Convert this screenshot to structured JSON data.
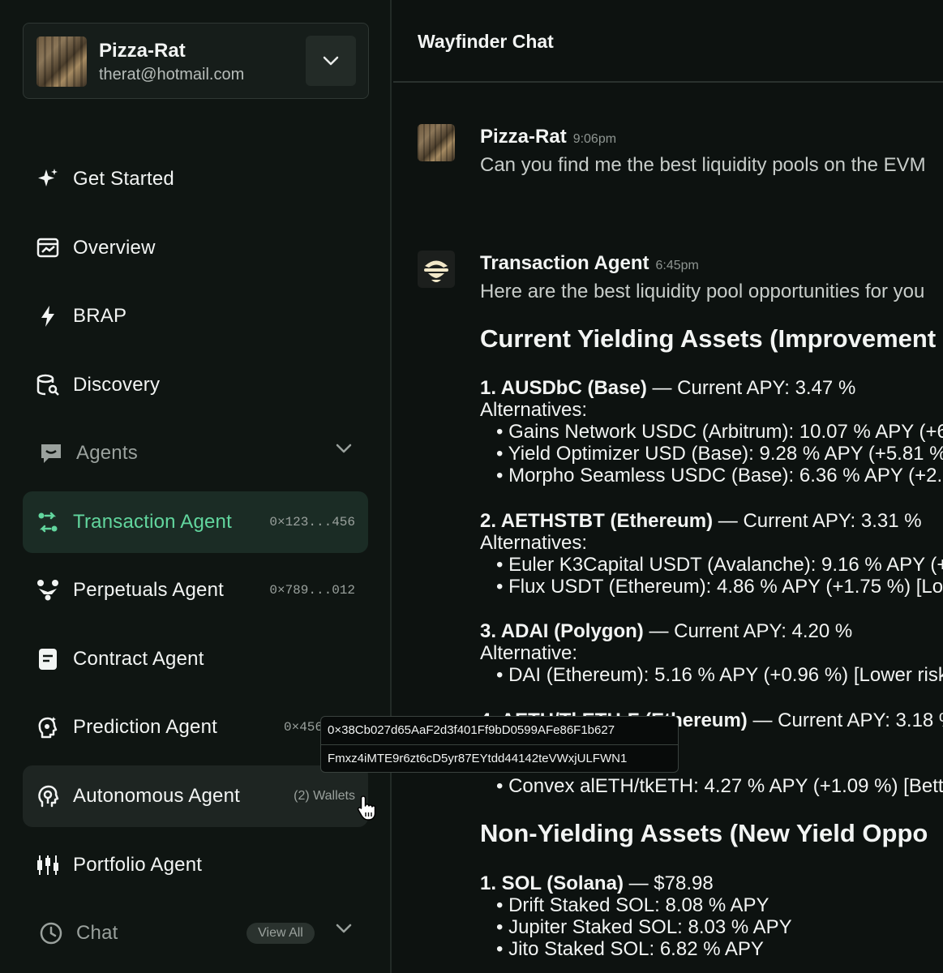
{
  "account": {
    "name": "Pizza-Rat",
    "email": "therat@hotmail.com"
  },
  "nav": {
    "get_started": "Get Started",
    "overview": "Overview",
    "brap": "BRAP",
    "discovery": "Discovery",
    "agents": "Agents",
    "chat": "Chat",
    "view_all": "View All",
    "agent_items": [
      {
        "label": "Transaction Agent",
        "meta": "0×123...456"
      },
      {
        "label": "Perpetuals Agent",
        "meta": "0×789...012"
      },
      {
        "label": "Contract Agent",
        "meta": ""
      },
      {
        "label": "Prediction Agent",
        "meta": "0×456"
      },
      {
        "label": "Autonomous Agent",
        "meta": "(2) Wallets"
      },
      {
        "label": "Portfolio Agent",
        "meta": ""
      }
    ]
  },
  "tooltip": {
    "evm_address": "0×38Cb027d65AaF2d3f401Ff9bD0599AFe86F1b627",
    "sol_address": "Fmxz4iMTE9r6zt6cD5yr87EYtdd44142teVWxjULFWN1"
  },
  "chat": {
    "title": "Wayfinder Chat",
    "messages": [
      {
        "author": "Pizza-Rat",
        "time": "9:06pm",
        "text": "Can you find me the best liquidity pools on the EVM"
      },
      {
        "author": "Transaction Agent",
        "time": "6:45pm",
        "text": "Here are the best liquidity pool opportunities for you"
      }
    ],
    "content": {
      "heading1": "Current Yielding Assets (Improvement",
      "a1_title": "1. AUSDbC (Base)",
      "a1_rest": " — Current APY: 3.47 %",
      "a1_alt": "Alternatives:",
      "a1_b1": "• Gains Network USDC (Arbitrum): 10.07 % APY (+6",
      "a1_b2": "• Yield Optimizer USD (Base): 9.28 % APY (+5.81 %",
      "a1_b3": "• Morpho Seamless USDC (Base): 6.36 % APY (+2.",
      "a2_title": "2. AETHSTBT (Ethereum)",
      "a2_rest": " — Current APY: 3.31 %",
      "a2_alt": "Alternatives:",
      "a2_b1": "• Euler K3Capital USDT (Avalanche): 9.16 % APY (+",
      "a2_b2": "• Flux USDT (Ethereum): 4.86 % APY (+1.75 %) [Low",
      "a3_title": "3. ADAI (Polygon)",
      "a3_rest": " — Current APY: 4.20 %",
      "a3_alt": "Alternative:",
      "a3_b1": "• DAI (Ethereum): 5.16 % APY (+0.96 %) [Lower risk",
      "a4_title": "4. AETH/TkETH-F (Ethereum)",
      "a4_rest": " — Current APY: 3.18 %",
      "a4_b1": "• Convex alETH/tkETH: 4.27 % APY (+1.09 %) [Bett",
      "heading2": "Non-Yielding Assets (New Yield Oppo",
      "n1_title": "1. SOL (Solana)",
      "n1_rest": " — $78.98",
      "n1_b1": "• Drift Staked SOL: 8.08 % APY",
      "n1_b2": "• Jupiter Staked SOL: 8.03 % APY",
      "n1_b3": "• Jito Staked SOL: 6.82 % APY"
    }
  },
  "colors": {
    "accent": "#62d69e",
    "background": "#0d1210",
    "sidebar": "#0f1512",
    "active_bg": "#1b2c25"
  },
  "icons": [
    "sparkle-icon",
    "chart-window-icon",
    "lightning-icon",
    "database-search-icon",
    "chat-bubble-icon",
    "transfer-icon",
    "people-icon",
    "document-icon",
    "brain-icon",
    "head-icon",
    "candlestick-icon",
    "clock-icon",
    "chevron-down-icon",
    "pointer-cursor-icon"
  ]
}
